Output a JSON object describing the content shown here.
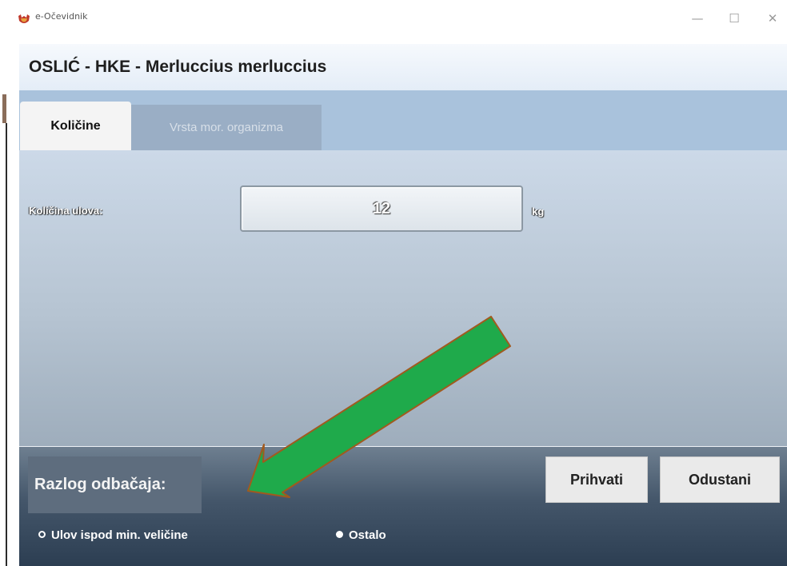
{
  "window": {
    "app_title": "e-Očevidnik",
    "controls": {
      "minimize": "—",
      "maximize": "☐",
      "close": "✕"
    }
  },
  "header": {
    "title": "OSLIĆ - HKE - Merluccius merluccius"
  },
  "tabs": [
    {
      "label": "Količine",
      "active": true
    },
    {
      "label": "Vrsta mor. organizma",
      "active": false
    }
  ],
  "quantity": {
    "label": "Količina ulova:",
    "value": "12",
    "unit": "kg"
  },
  "footer": {
    "reason_label": "Razlog odbačaja:",
    "accept_label": "Prihvati",
    "cancel_label": "Odustani",
    "options": [
      {
        "label": "Ulov ispod min. veličine",
        "selected": false
      },
      {
        "label": "Ostalo",
        "selected": true
      }
    ]
  },
  "annotation": {
    "type": "arrow",
    "color": "#1faa4b",
    "outline": "#a15a1e"
  }
}
